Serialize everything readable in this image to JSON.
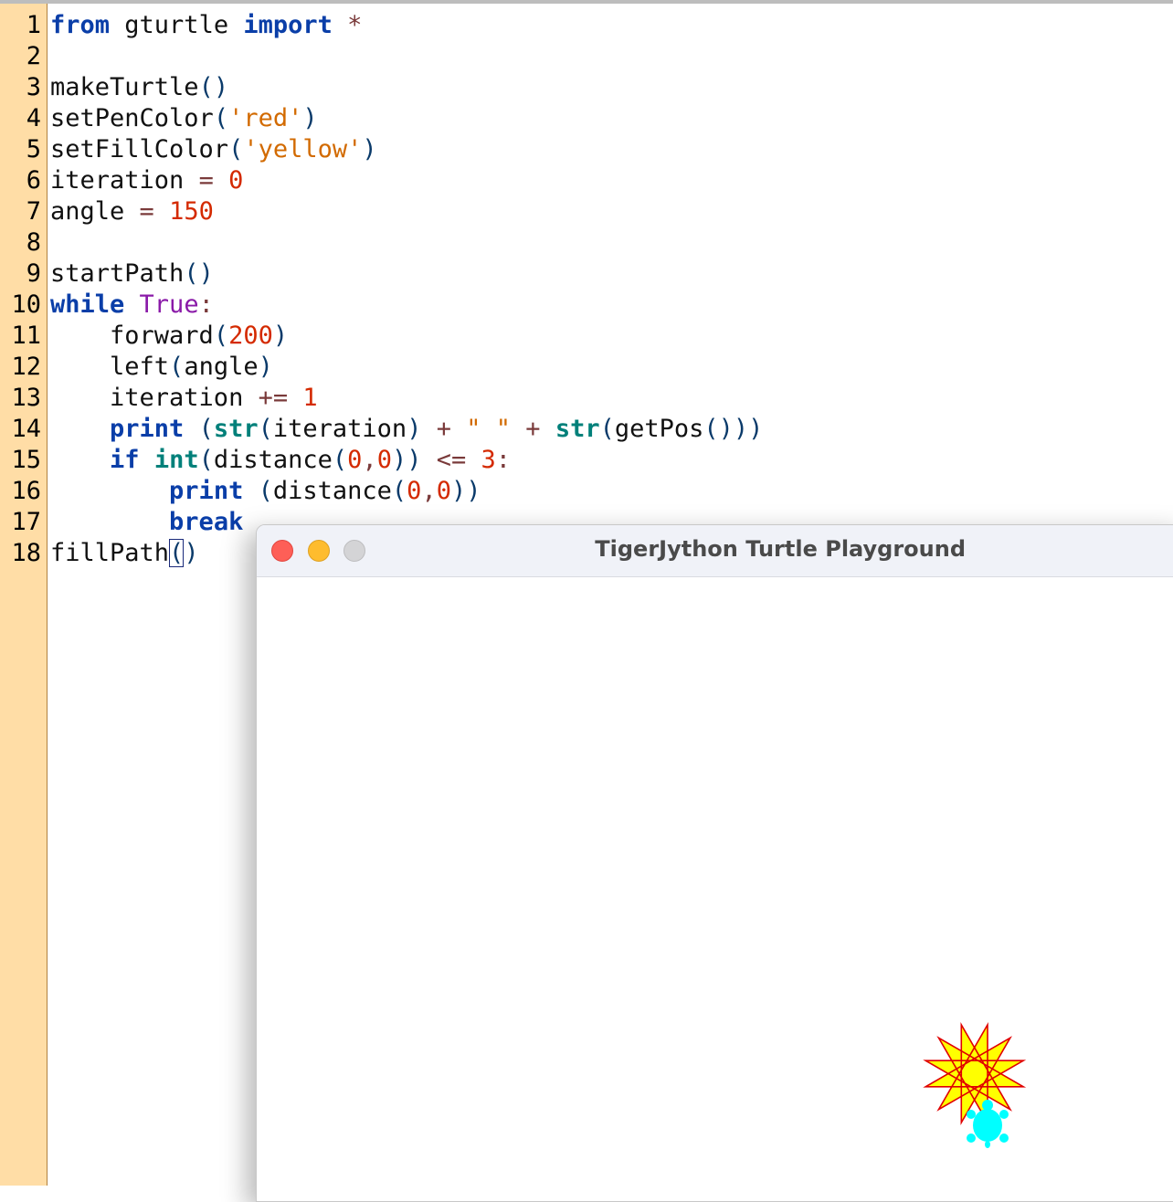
{
  "editor": {
    "line_numbers": [
      "1",
      "2",
      "3",
      "4",
      "5",
      "6",
      "7",
      "8",
      "9",
      "10",
      "11",
      "12",
      "13",
      "14",
      "15",
      "16",
      "17",
      "18"
    ],
    "lines": [
      [
        {
          "t": "from",
          "c": "kw"
        },
        {
          "t": " gturtle ",
          "c": ""
        },
        {
          "t": "import",
          "c": "kw"
        },
        {
          "t": " *",
          "c": "op"
        }
      ],
      [],
      [
        {
          "t": "makeTurtle",
          "c": ""
        },
        {
          "t": "()",
          "c": "par"
        }
      ],
      [
        {
          "t": "setPenColor",
          "c": ""
        },
        {
          "t": "(",
          "c": "par"
        },
        {
          "t": "'red'",
          "c": "str"
        },
        {
          "t": ")",
          "c": "par"
        }
      ],
      [
        {
          "t": "setFillColor",
          "c": ""
        },
        {
          "t": "(",
          "c": "par"
        },
        {
          "t": "'yellow'",
          "c": "str"
        },
        {
          "t": ")",
          "c": "par"
        }
      ],
      [
        {
          "t": "iteration ",
          "c": ""
        },
        {
          "t": "=",
          "c": "op"
        },
        {
          "t": " ",
          "c": ""
        },
        {
          "t": "0",
          "c": "num"
        }
      ],
      [
        {
          "t": "angle ",
          "c": ""
        },
        {
          "t": "=",
          "c": "op"
        },
        {
          "t": " ",
          "c": ""
        },
        {
          "t": "150",
          "c": "num"
        }
      ],
      [],
      [
        {
          "t": "startPath",
          "c": ""
        },
        {
          "t": "()",
          "c": "par"
        }
      ],
      [
        {
          "t": "while",
          "c": "kw"
        },
        {
          "t": " ",
          "c": ""
        },
        {
          "t": "True",
          "c": "tr"
        },
        {
          "t": ":",
          "c": "op"
        }
      ],
      [
        {
          "t": "    forward",
          "c": ""
        },
        {
          "t": "(",
          "c": "par"
        },
        {
          "t": "200",
          "c": "num"
        },
        {
          "t": ")",
          "c": "par"
        }
      ],
      [
        {
          "t": "    left",
          "c": ""
        },
        {
          "t": "(",
          "c": "par"
        },
        {
          "t": "angle",
          "c": ""
        },
        {
          "t": ")",
          "c": "par"
        }
      ],
      [
        {
          "t": "    iteration ",
          "c": ""
        },
        {
          "t": "+=",
          "c": "op"
        },
        {
          "t": " ",
          "c": ""
        },
        {
          "t": "1",
          "c": "num"
        }
      ],
      [
        {
          "t": "    ",
          "c": ""
        },
        {
          "t": "print",
          "c": "kw"
        },
        {
          "t": " ",
          "c": ""
        },
        {
          "t": "(",
          "c": "par"
        },
        {
          "t": "str",
          "c": "bi"
        },
        {
          "t": "(",
          "c": "par"
        },
        {
          "t": "iteration",
          "c": ""
        },
        {
          "t": ")",
          "c": "par"
        },
        {
          "t": " + ",
          "c": "op"
        },
        {
          "t": "\" \"",
          "c": "str"
        },
        {
          "t": " + ",
          "c": "op"
        },
        {
          "t": "str",
          "c": "bi"
        },
        {
          "t": "(",
          "c": "par"
        },
        {
          "t": "getPos",
          "c": ""
        },
        {
          "t": "()))",
          "c": "par"
        }
      ],
      [
        {
          "t": "    ",
          "c": ""
        },
        {
          "t": "if",
          "c": "kw"
        },
        {
          "t": " ",
          "c": ""
        },
        {
          "t": "int",
          "c": "bi"
        },
        {
          "t": "(",
          "c": "par"
        },
        {
          "t": "distance",
          "c": ""
        },
        {
          "t": "(",
          "c": "par"
        },
        {
          "t": "0",
          "c": "num"
        },
        {
          "t": ",",
          "c": "op"
        },
        {
          "t": "0",
          "c": "num"
        },
        {
          "t": "))",
          "c": "par"
        },
        {
          "t": " <= ",
          "c": "op"
        },
        {
          "t": "3",
          "c": "num"
        },
        {
          "t": ":",
          "c": "op"
        }
      ],
      [
        {
          "t": "        ",
          "c": ""
        },
        {
          "t": "print",
          "c": "kw"
        },
        {
          "t": " ",
          "c": ""
        },
        {
          "t": "(",
          "c": "par"
        },
        {
          "t": "distance",
          "c": ""
        },
        {
          "t": "(",
          "c": "par"
        },
        {
          "t": "0",
          "c": "num"
        },
        {
          "t": ",",
          "c": "op"
        },
        {
          "t": "0",
          "c": "num"
        },
        {
          "t": "))",
          "c": "par"
        }
      ],
      [
        {
          "t": "        ",
          "c": ""
        },
        {
          "t": "break",
          "c": "kw"
        }
      ],
      [
        {
          "t": "fillPath",
          "c": ""
        },
        {
          "t": "(",
          "c": "par cursor-box"
        },
        {
          "t": ")",
          "c": "par"
        }
      ]
    ]
  },
  "turtle_window": {
    "title": "TigerJython Turtle Playground",
    "pen_color": "#e00000",
    "fill_color": "#ffff00",
    "turtle_color": "#00ffff",
    "canvas_background": "#ffffff"
  },
  "colors": {
    "gutter": "#ffdda6",
    "keyword": "#0a3ea8",
    "number": "#d42a00",
    "string": "#d26a00"
  }
}
